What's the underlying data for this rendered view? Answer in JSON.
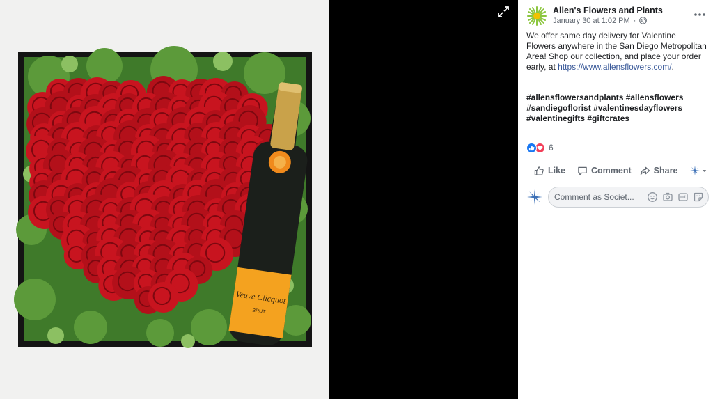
{
  "viewer": {
    "photo_alt": "Heart of red roses with a Veuve Clicquot bottle in a moss-filled box",
    "bottle_label": "Veuve Clicquot",
    "bottle_sublabel": "BRUT"
  },
  "post": {
    "page_name": "Allen's Flowers and Plants",
    "timestamp": "January 30 at 1:02 PM",
    "separator": "·",
    "text": "We offer same day delivery for Valentine Flowers anywhere in the San Diego Metropolitan Area! Shop our collection, and place your order early, at ",
    "link": "https://www.allensflowers.com/",
    "text_end": ".",
    "hashtags": "#allensflowersandplants #allensflowers #sandiegoflorist #valentinesdayflowers #valentinegifts #giftcrates"
  },
  "reactions": {
    "count": "6"
  },
  "actions": {
    "like": "Like",
    "comment": "Comment",
    "share": "Share"
  },
  "composer": {
    "placeholder": "Comment as Societ..."
  },
  "colors": {
    "link": "#385898",
    "like_blue": "#1877f2",
    "love_red": "#f33e58",
    "text_gray": "#606770"
  }
}
